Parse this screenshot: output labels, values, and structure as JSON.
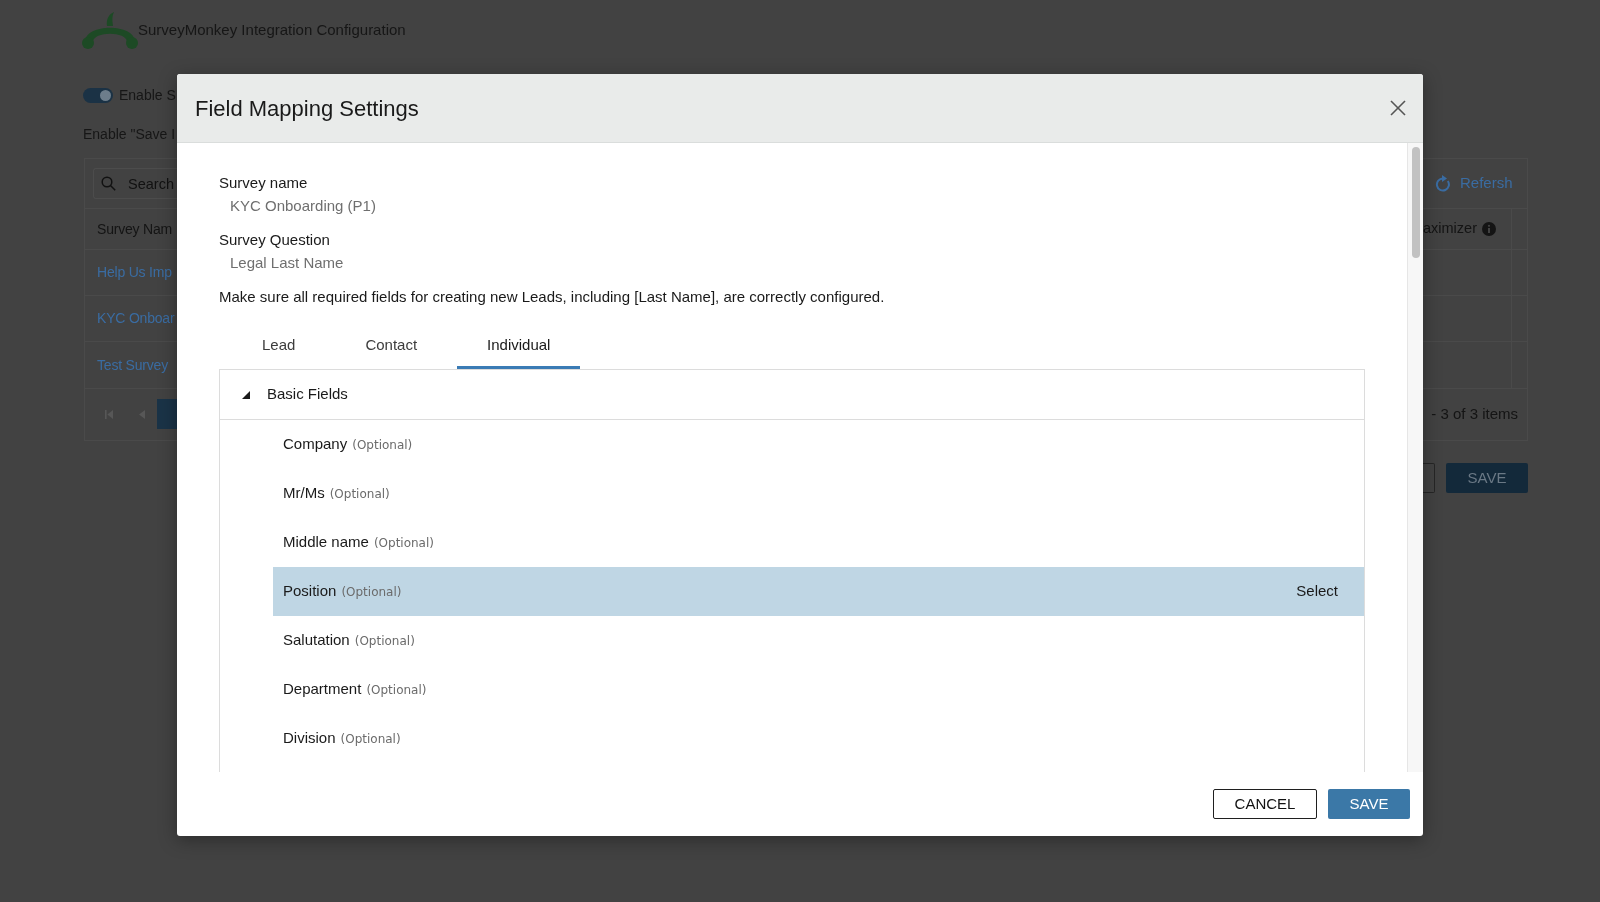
{
  "page": {
    "title": "SurveyMonkey Integration Configuration",
    "enable_toggle": {
      "label": "Enable S",
      "on": true
    },
    "save_option": {
      "label": "Enable \"Save I"
    },
    "surveys_table": {
      "search": {
        "placeholder": "Search"
      },
      "refresh_label": "Refersh",
      "columns": [
        {
          "label": "Survey Nam"
        },
        {
          "label": "aximizer"
        }
      ],
      "rows": [
        {
          "survey_name": "Help Us Imp"
        },
        {
          "survey_name": "KYC Onboar"
        },
        {
          "survey_name": "Test Survey"
        }
      ],
      "pagination_summary": "- 3 of 3 items"
    },
    "buttons": [
      {
        "kind": "outline"
      },
      {
        "kind": "primary",
        "label": "SAVE"
      }
    ]
  },
  "dialog": {
    "title": "Field Mapping Settings",
    "details": [
      {
        "label": "Survey name",
        "value": "KYC Onboarding (P1)"
      },
      {
        "label": "Survey Question",
        "value": "Legal Last Name"
      }
    ],
    "notice": "Make sure all required fields for creating new Leads, including [Last Name], are correctly configured.",
    "tabs": [
      {
        "label": "Lead",
        "selected": false
      },
      {
        "label": "Contact",
        "selected": false
      },
      {
        "label": "Individual",
        "selected": true
      }
    ],
    "section": {
      "title": "Basic Fields",
      "expanded": true,
      "fields": [
        {
          "label": "Company",
          "note": "(Optional)",
          "selected": false
        },
        {
          "label": "Mr/Ms",
          "note": "(Optional)",
          "selected": false
        },
        {
          "label": "Middle name",
          "note": "(Optional)",
          "selected": false
        },
        {
          "label": "Position",
          "note": "(Optional)",
          "selected": true,
          "action": "Select"
        },
        {
          "label": "Salutation",
          "note": "(Optional)",
          "selected": false
        },
        {
          "label": "Department",
          "note": "(Optional)",
          "selected": false
        },
        {
          "label": "Division",
          "note": "(Optional)",
          "selected": false
        }
      ]
    },
    "buttons": [
      {
        "kind": "secondary",
        "label": "CANCEL"
      },
      {
        "kind": "primary",
        "label": "SAVE"
      }
    ]
  }
}
